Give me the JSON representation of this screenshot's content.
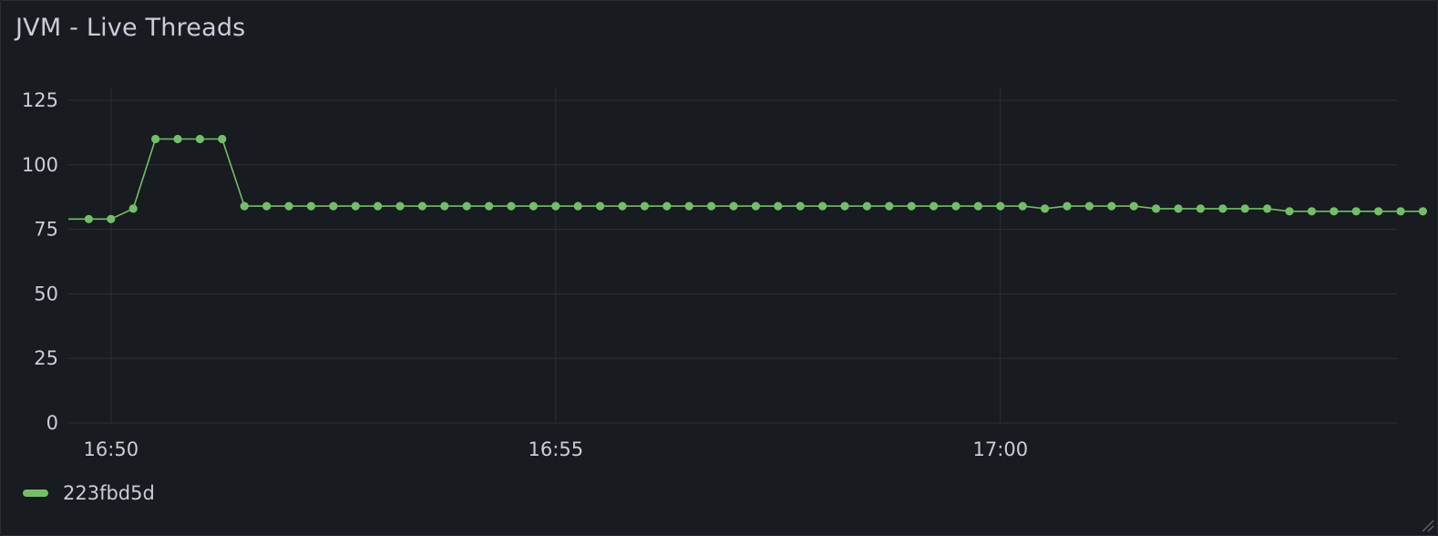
{
  "panel": {
    "title": "JVM - Live Threads"
  },
  "colors": {
    "background": "#181b1f",
    "series": "#73bf69",
    "grid": "#2c3035",
    "text": "#ccccdc"
  },
  "chart_data": {
    "type": "line",
    "title": "JVM - Live Threads",
    "xlabel": "",
    "ylabel": "",
    "ylim": [
      0,
      125
    ],
    "yticks": [
      0,
      25,
      50,
      75,
      100,
      125
    ],
    "xticks": [
      "16:50",
      "16:55",
      "17:00"
    ],
    "x_start": "16:49:30",
    "x_end": "17:04:30",
    "interval_seconds": 15,
    "grid": true,
    "points": true,
    "legend_position": "bottom-left",
    "series": [
      {
        "name": "223fbd5d",
        "color": "#73bf69",
        "leading_value": 79,
        "values": [
          79,
          79,
          83,
          110,
          110,
          110,
          110,
          84,
          84,
          84,
          84,
          84,
          84,
          84,
          84,
          84,
          84,
          84,
          84,
          84,
          84,
          84,
          84,
          84,
          84,
          84,
          84,
          84,
          84,
          84,
          84,
          84,
          84,
          84,
          84,
          84,
          84,
          84,
          84,
          84,
          84,
          84,
          84,
          83,
          84,
          84,
          84,
          84,
          83,
          83,
          83,
          83,
          83,
          83,
          82,
          82,
          82,
          82,
          82,
          82,
          82
        ]
      }
    ]
  },
  "legend": {
    "items": [
      {
        "label": "223fbd5d",
        "color": "#73bf69"
      }
    ]
  }
}
